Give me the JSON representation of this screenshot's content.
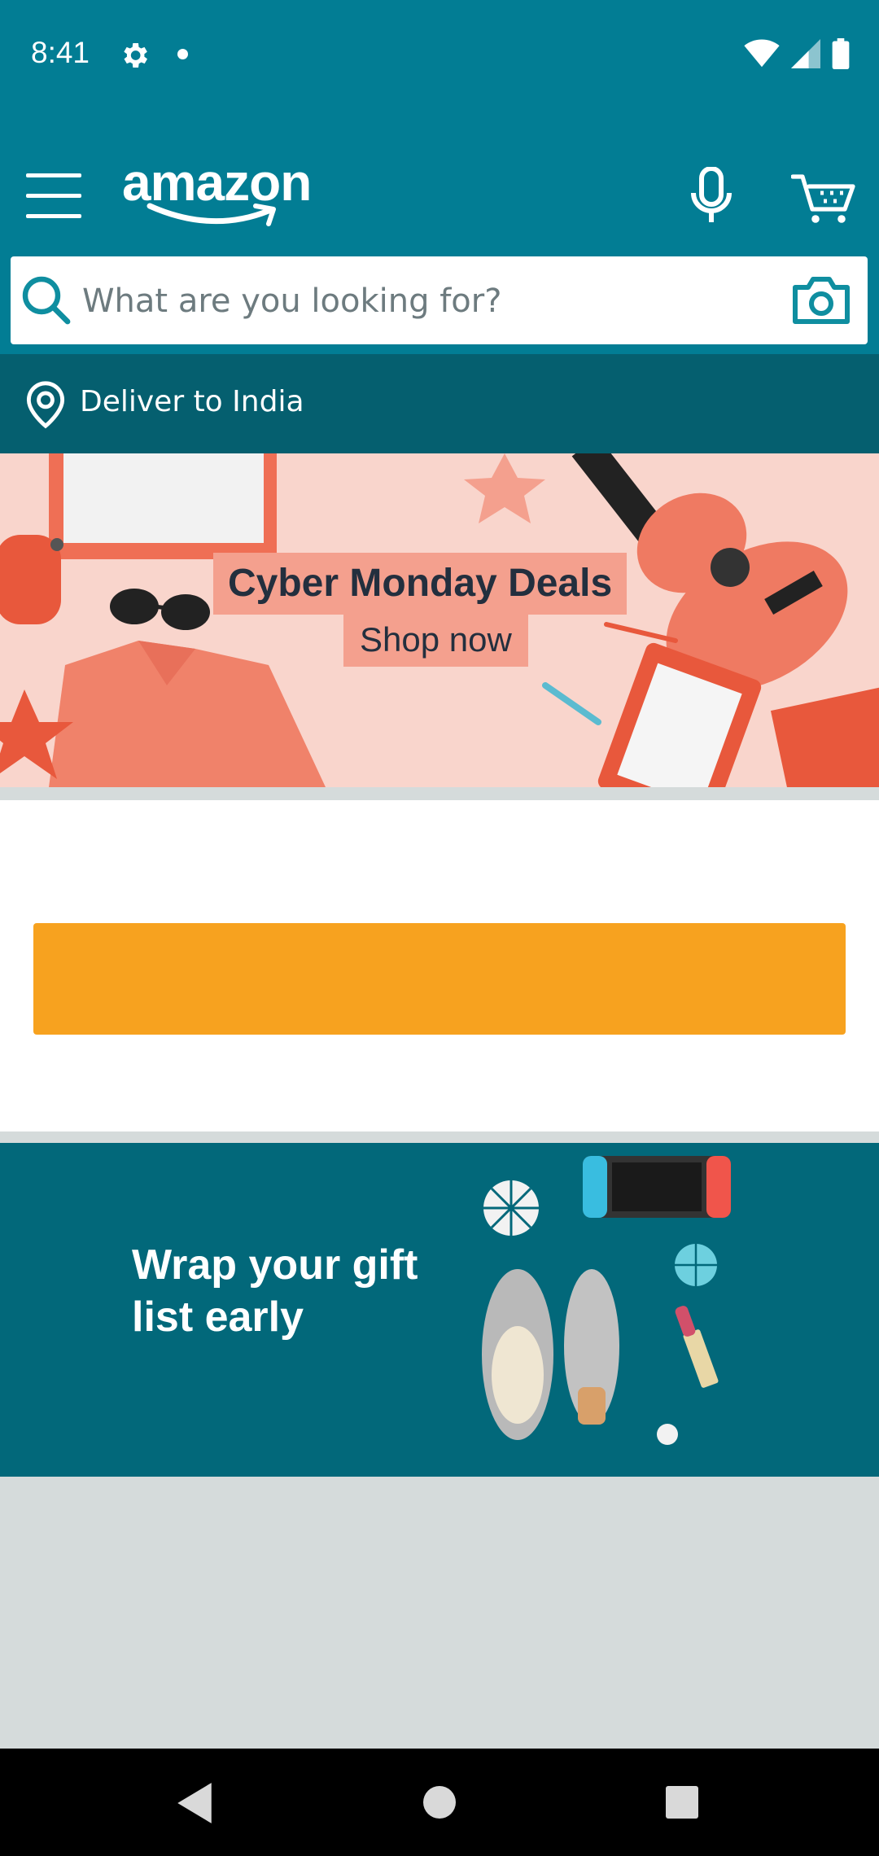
{
  "status_bar": {
    "time": "8:41"
  },
  "header": {
    "logo_text": "amazon",
    "search": {
      "placeholder": "What are you looking for?"
    },
    "deliver_text": "Deliver to India"
  },
  "banners": {
    "cyber_monday": {
      "title": "Cyber Monday Deals",
      "cta": "Shop now"
    },
    "gift": {
      "line1": "Wrap your gift",
      "line2": "list early"
    }
  },
  "colors": {
    "header_bg": "#027d94",
    "deliver_bg": "#055f6f",
    "accent_orange": "#f7a21f",
    "banner2_bg": "#02687a"
  }
}
